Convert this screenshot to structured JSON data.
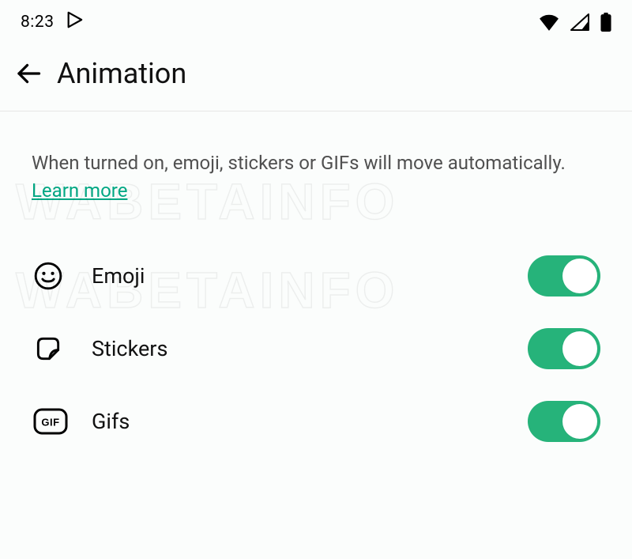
{
  "status_bar": {
    "time": "8:23"
  },
  "app_bar": {
    "title": "Animation"
  },
  "description": {
    "text": "When turned on, emoji, stickers or GIFs will move automatically. ",
    "learn_more": "Learn more"
  },
  "settings": [
    {
      "id": "emoji",
      "label": "Emoji",
      "on": true
    },
    {
      "id": "stickers",
      "label": "Stickers",
      "on": true
    },
    {
      "id": "gifs",
      "label": "Gifs",
      "on": true
    }
  ],
  "watermark": "WABETAINFO",
  "colors": {
    "accent": "#26b37a",
    "link": "#00a884"
  }
}
